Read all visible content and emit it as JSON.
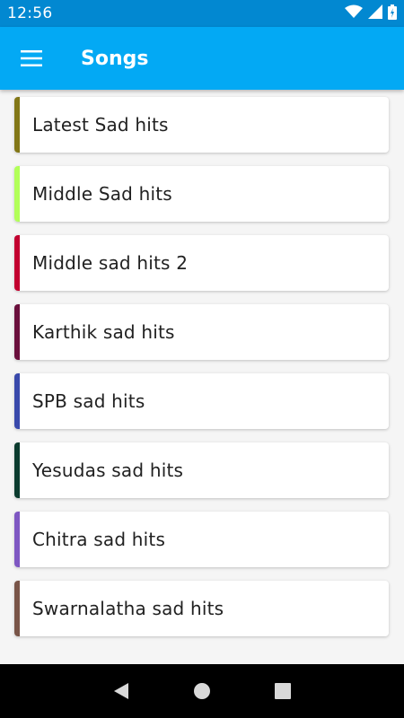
{
  "status_bar": {
    "time": "12:56",
    "icons": [
      "wifi-icon",
      "signal-icon",
      "battery-icon"
    ]
  },
  "app_bar": {
    "title": "Songs",
    "menu_icon": "hamburger-menu-icon"
  },
  "songs": {
    "items": [
      {
        "label": "Latest Sad hits",
        "color": "#827717"
      },
      {
        "label": "Middle Sad hits",
        "color": "#b2ff59"
      },
      {
        "label": "Middle sad hits 2",
        "color": "#c2002f"
      },
      {
        "label": "Karthik sad hits",
        "color": "#6a0f3c"
      },
      {
        "label": "SPB sad hits",
        "color": "#3949ab"
      },
      {
        "label": "Yesudas sad hits",
        "color": "#0b3b2e"
      },
      {
        "label": "Chitra sad hits",
        "color": "#7e57c2"
      },
      {
        "label": "Swarnalatha sad hits",
        "color": "#795548"
      }
    ]
  },
  "nav_bar": {
    "back_icon": "back-triangle-icon",
    "home_icon": "home-circle-icon",
    "recents_icon": "recents-square-icon"
  },
  "colors": {
    "status_bar": "#0288d1",
    "app_bar": "#03a9f4",
    "background": "#f5f5f5"
  }
}
